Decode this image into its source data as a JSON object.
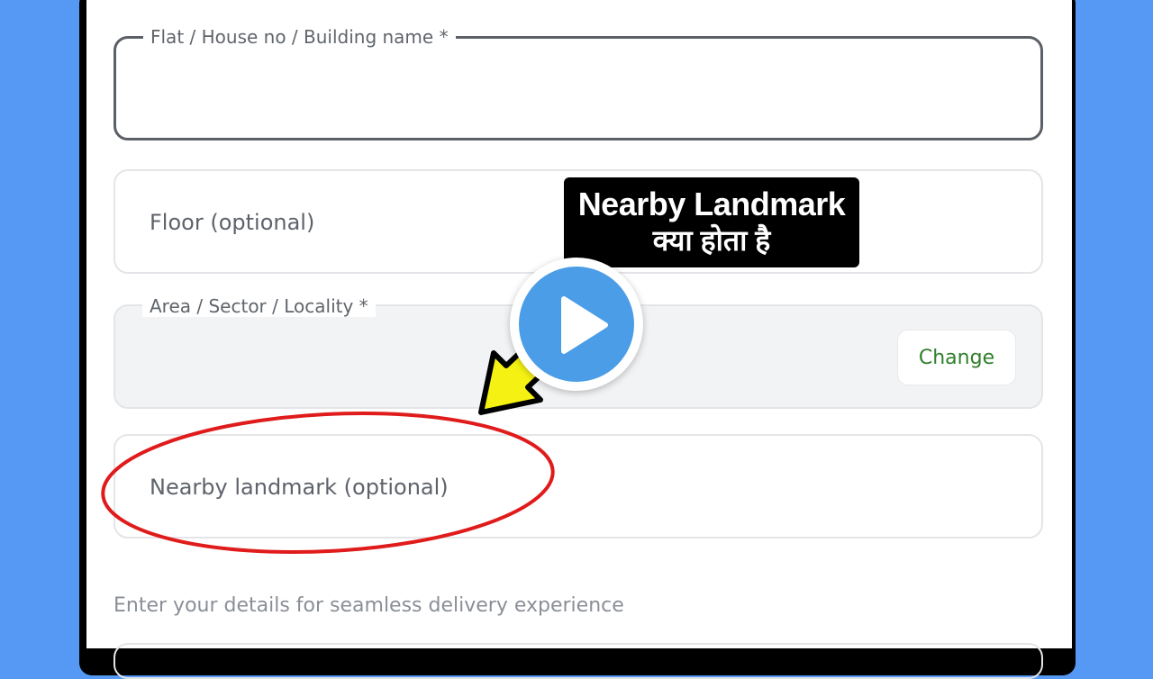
{
  "form": {
    "flat_label": "Flat / House no / Building name *",
    "flat_value": "",
    "floor_placeholder": "Floor (optional)",
    "area_label": "Area / Sector / Locality *",
    "area_value": "",
    "change_label": "Change",
    "landmark_placeholder": "Nearby landmark (optional)",
    "hint_text": "Enter your details for seamless delivery experience"
  },
  "overlay": {
    "callout_line1": "Nearby Landmark",
    "callout_line2": "क्या होता है",
    "play_icon": "play-icon",
    "arrow_icon": "arrow-pointer-icon",
    "highlight_shape": "red-ellipse"
  },
  "colors": {
    "background": "#5599f5",
    "play_blue": "#4a9de6",
    "change_green": "#2f7f2a",
    "arrow_yellow": "#f5f213",
    "ellipse_red": "#e01b1b"
  }
}
